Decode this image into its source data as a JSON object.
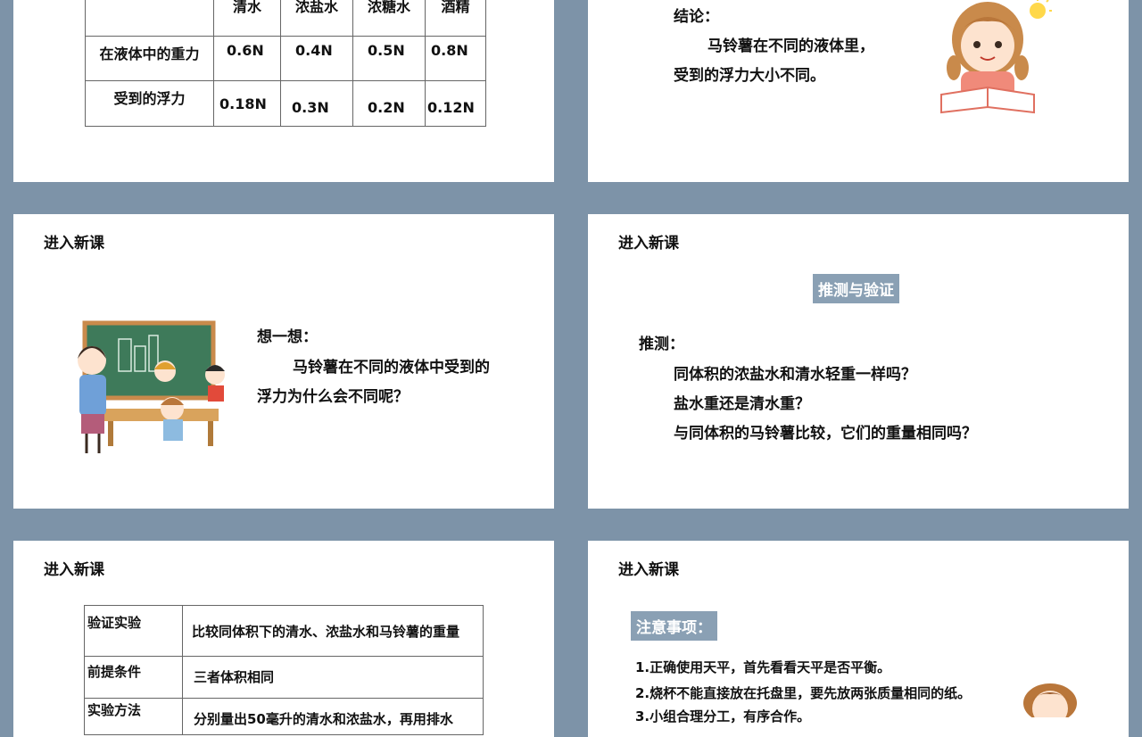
{
  "slide1": {
    "table": {
      "headers": [
        "",
        "清水",
        "浓盐水",
        "浓糖水",
        "酒精"
      ],
      "rows": [
        [
          "在液体中的重力",
          "0.6N",
          "0.4N",
          "0.5N",
          "0.8N"
        ],
        [
          "受到的浮力",
          "0.18N",
          "0.3N",
          "0.2N",
          "0.12N"
        ]
      ]
    }
  },
  "slide2": {
    "conclusion_label": "结论：",
    "line1": "马铃薯在不同的液体里，",
    "line2": "受到的浮力大小不同。"
  },
  "slide3": {
    "title": "进入新课",
    "think_label": "想一想：",
    "line1": "马铃薯在不同的液体中受到的",
    "line2": "浮力为什么会不同呢？"
  },
  "slide4": {
    "title": "进入新课",
    "badge": "推测与验证",
    "guess_label": "推测：",
    "q1": "同体积的浓盐水和清水轻重一样吗？",
    "q2": "盐水重还是清水重？",
    "q3": "与同体积的马铃薯比较，它们的重量相同吗？"
  },
  "slide5": {
    "title": "进入新课",
    "table": {
      "rows": [
        [
          "验证实验",
          "比较同体积下的清水、浓盐水和马铃薯的重量"
        ],
        [
          "前提条件",
          "三者体积相同"
        ],
        [
          "实验方法",
          "分别量出50毫升的清水和浓盐水，再用排水"
        ]
      ]
    }
  },
  "slide6": {
    "title": "进入新课",
    "badge": "注意事项：",
    "item1": "1.正确使用天平，首先看看天平是否平衡。",
    "item2": "2.烧杯不能直接放在托盘里，要先放两张质量相同的纸。",
    "item3": "3.小组合理分工，有序合作。"
  },
  "colors": {
    "background": "#7d93a8",
    "badge": "#8aa0b4",
    "slide": "#ffffff"
  }
}
